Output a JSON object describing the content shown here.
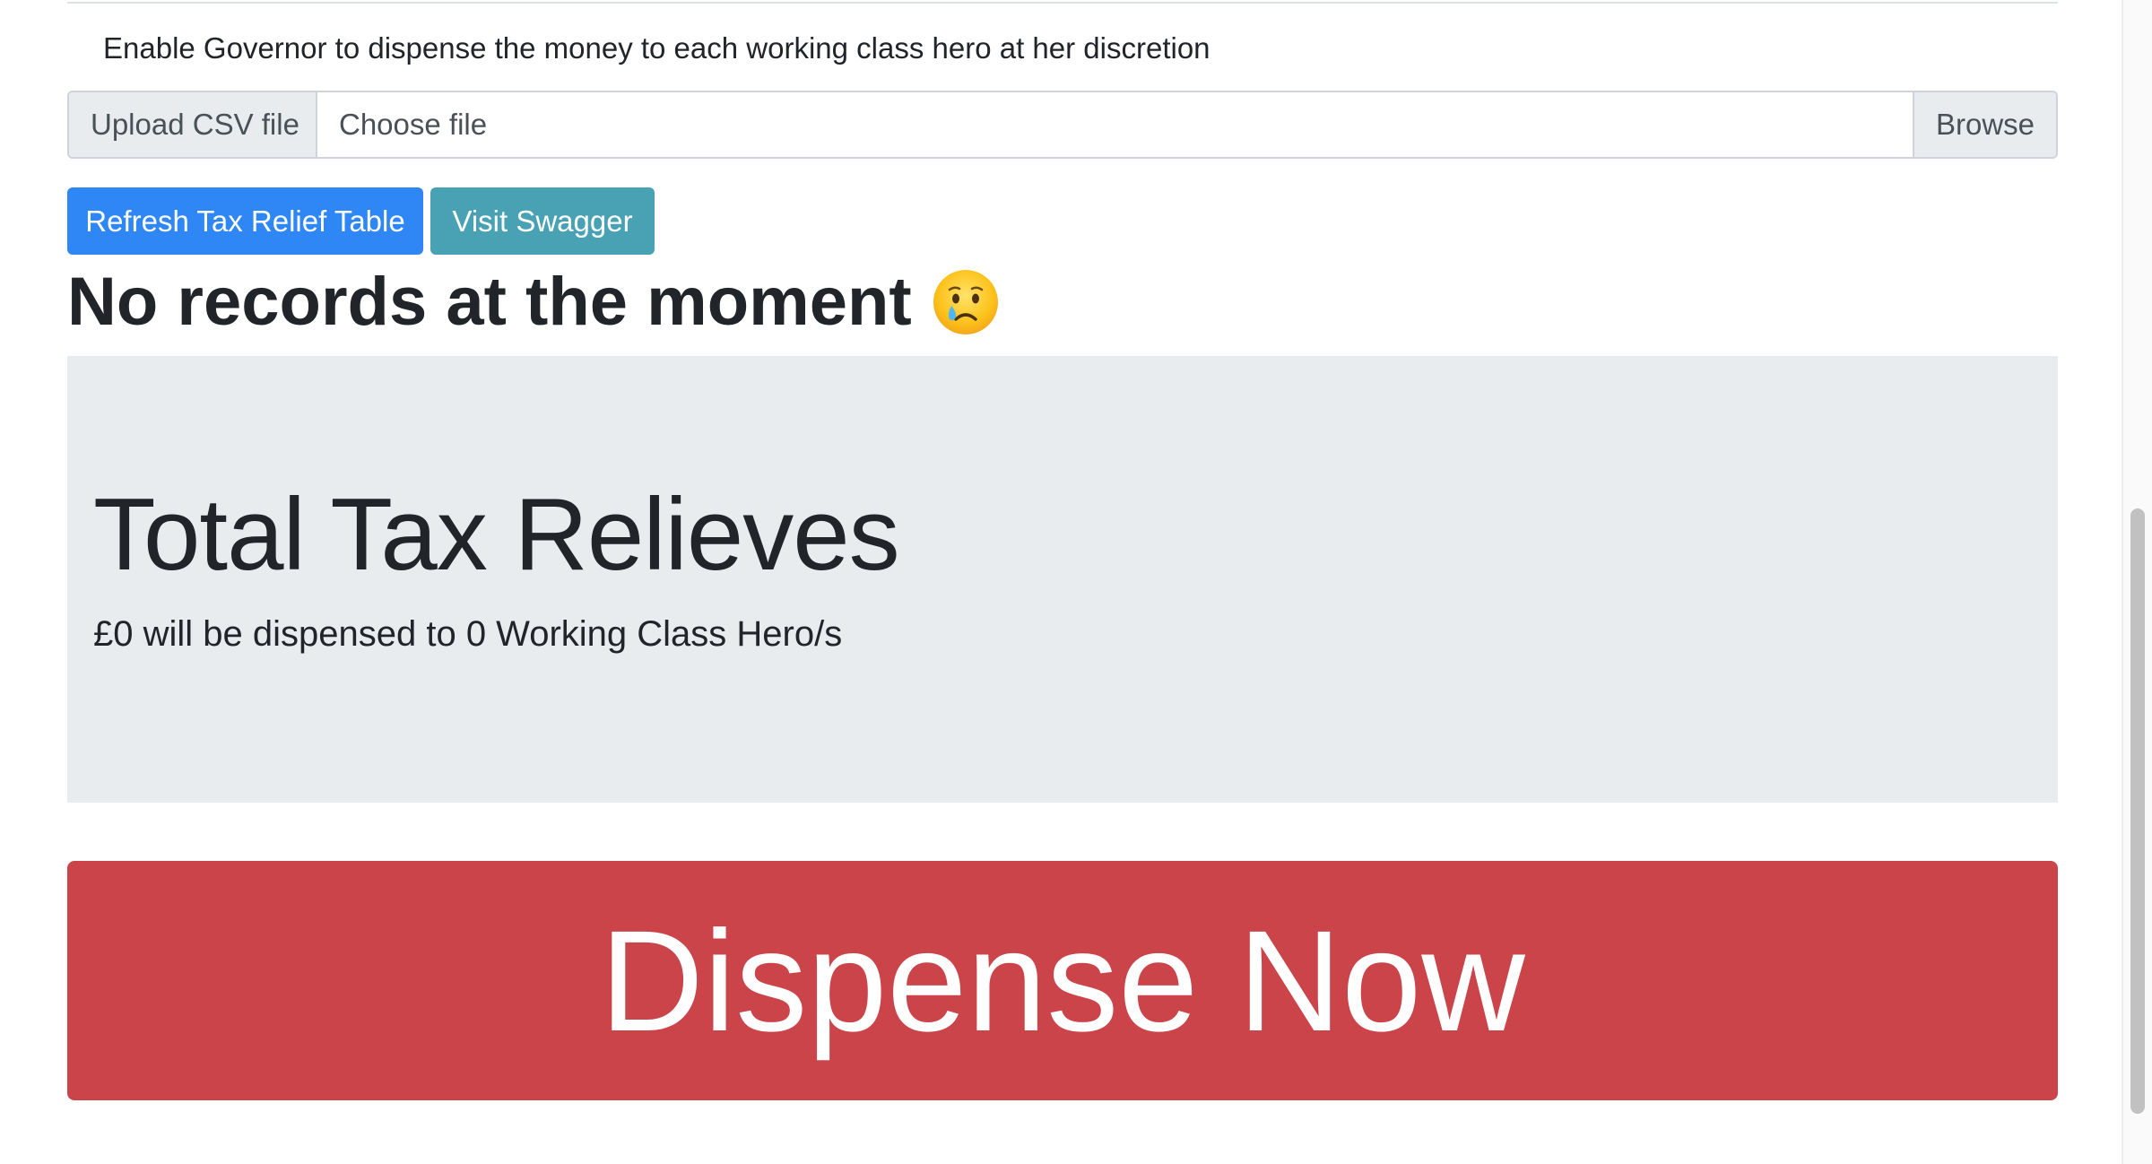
{
  "governor_note": "Enable Governor to dispense the money to each working class hero at her discretion",
  "upload": {
    "prefix_label": "Upload CSV file",
    "file_placeholder": "Choose file",
    "browse_label": "Browse"
  },
  "actions": {
    "refresh_label": "Refresh Tax Relief Table",
    "swagger_label": "Visit Swagger"
  },
  "records": {
    "empty_message": "No records at the moment",
    "empty_icon": "crying-face-emoji"
  },
  "summary": {
    "title": "Total Tax Relieves",
    "lead": "£0 will be dispensed to 0 Working Class Hero/s"
  },
  "dispense": {
    "label": "Dispense Now"
  },
  "colors": {
    "primary": "#2f86f5",
    "info": "#48a2b4",
    "danger": "#cb444a",
    "jumbotron": "#e9ecef"
  }
}
